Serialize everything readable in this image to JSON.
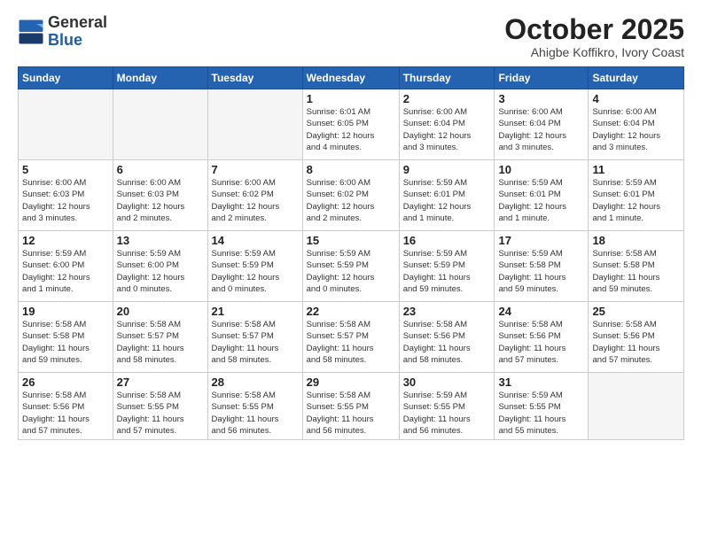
{
  "header": {
    "logo_line1": "General",
    "logo_line2": "Blue",
    "month": "October 2025",
    "location": "Ahigbe Koffikro, Ivory Coast"
  },
  "weekdays": [
    "Sunday",
    "Monday",
    "Tuesday",
    "Wednesday",
    "Thursday",
    "Friday",
    "Saturday"
  ],
  "weeks": [
    [
      {
        "day": "",
        "info": ""
      },
      {
        "day": "",
        "info": ""
      },
      {
        "day": "",
        "info": ""
      },
      {
        "day": "1",
        "info": "Sunrise: 6:01 AM\nSunset: 6:05 PM\nDaylight: 12 hours\nand 4 minutes."
      },
      {
        "day": "2",
        "info": "Sunrise: 6:00 AM\nSunset: 6:04 PM\nDaylight: 12 hours\nand 3 minutes."
      },
      {
        "day": "3",
        "info": "Sunrise: 6:00 AM\nSunset: 6:04 PM\nDaylight: 12 hours\nand 3 minutes."
      },
      {
        "day": "4",
        "info": "Sunrise: 6:00 AM\nSunset: 6:04 PM\nDaylight: 12 hours\nand 3 minutes."
      }
    ],
    [
      {
        "day": "5",
        "info": "Sunrise: 6:00 AM\nSunset: 6:03 PM\nDaylight: 12 hours\nand 3 minutes."
      },
      {
        "day": "6",
        "info": "Sunrise: 6:00 AM\nSunset: 6:03 PM\nDaylight: 12 hours\nand 2 minutes."
      },
      {
        "day": "7",
        "info": "Sunrise: 6:00 AM\nSunset: 6:02 PM\nDaylight: 12 hours\nand 2 minutes."
      },
      {
        "day": "8",
        "info": "Sunrise: 6:00 AM\nSunset: 6:02 PM\nDaylight: 12 hours\nand 2 minutes."
      },
      {
        "day": "9",
        "info": "Sunrise: 5:59 AM\nSunset: 6:01 PM\nDaylight: 12 hours\nand 1 minute."
      },
      {
        "day": "10",
        "info": "Sunrise: 5:59 AM\nSunset: 6:01 PM\nDaylight: 12 hours\nand 1 minute."
      },
      {
        "day": "11",
        "info": "Sunrise: 5:59 AM\nSunset: 6:01 PM\nDaylight: 12 hours\nand 1 minute."
      }
    ],
    [
      {
        "day": "12",
        "info": "Sunrise: 5:59 AM\nSunset: 6:00 PM\nDaylight: 12 hours\nand 1 minute."
      },
      {
        "day": "13",
        "info": "Sunrise: 5:59 AM\nSunset: 6:00 PM\nDaylight: 12 hours\nand 0 minutes."
      },
      {
        "day": "14",
        "info": "Sunrise: 5:59 AM\nSunset: 5:59 PM\nDaylight: 12 hours\nand 0 minutes."
      },
      {
        "day": "15",
        "info": "Sunrise: 5:59 AM\nSunset: 5:59 PM\nDaylight: 12 hours\nand 0 minutes."
      },
      {
        "day": "16",
        "info": "Sunrise: 5:59 AM\nSunset: 5:59 PM\nDaylight: 11 hours\nand 59 minutes."
      },
      {
        "day": "17",
        "info": "Sunrise: 5:59 AM\nSunset: 5:58 PM\nDaylight: 11 hours\nand 59 minutes."
      },
      {
        "day": "18",
        "info": "Sunrise: 5:58 AM\nSunset: 5:58 PM\nDaylight: 11 hours\nand 59 minutes."
      }
    ],
    [
      {
        "day": "19",
        "info": "Sunrise: 5:58 AM\nSunset: 5:58 PM\nDaylight: 11 hours\nand 59 minutes."
      },
      {
        "day": "20",
        "info": "Sunrise: 5:58 AM\nSunset: 5:57 PM\nDaylight: 11 hours\nand 58 minutes."
      },
      {
        "day": "21",
        "info": "Sunrise: 5:58 AM\nSunset: 5:57 PM\nDaylight: 11 hours\nand 58 minutes."
      },
      {
        "day": "22",
        "info": "Sunrise: 5:58 AM\nSunset: 5:57 PM\nDaylight: 11 hours\nand 58 minutes."
      },
      {
        "day": "23",
        "info": "Sunrise: 5:58 AM\nSunset: 5:56 PM\nDaylight: 11 hours\nand 58 minutes."
      },
      {
        "day": "24",
        "info": "Sunrise: 5:58 AM\nSunset: 5:56 PM\nDaylight: 11 hours\nand 57 minutes."
      },
      {
        "day": "25",
        "info": "Sunrise: 5:58 AM\nSunset: 5:56 PM\nDaylight: 11 hours\nand 57 minutes."
      }
    ],
    [
      {
        "day": "26",
        "info": "Sunrise: 5:58 AM\nSunset: 5:56 PM\nDaylight: 11 hours\nand 57 minutes."
      },
      {
        "day": "27",
        "info": "Sunrise: 5:58 AM\nSunset: 5:55 PM\nDaylight: 11 hours\nand 57 minutes."
      },
      {
        "day": "28",
        "info": "Sunrise: 5:58 AM\nSunset: 5:55 PM\nDaylight: 11 hours\nand 56 minutes."
      },
      {
        "day": "29",
        "info": "Sunrise: 5:58 AM\nSunset: 5:55 PM\nDaylight: 11 hours\nand 56 minutes."
      },
      {
        "day": "30",
        "info": "Sunrise: 5:59 AM\nSunset: 5:55 PM\nDaylight: 11 hours\nand 56 minutes."
      },
      {
        "day": "31",
        "info": "Sunrise: 5:59 AM\nSunset: 5:55 PM\nDaylight: 11 hours\nand 55 minutes."
      },
      {
        "day": "",
        "info": ""
      }
    ]
  ]
}
